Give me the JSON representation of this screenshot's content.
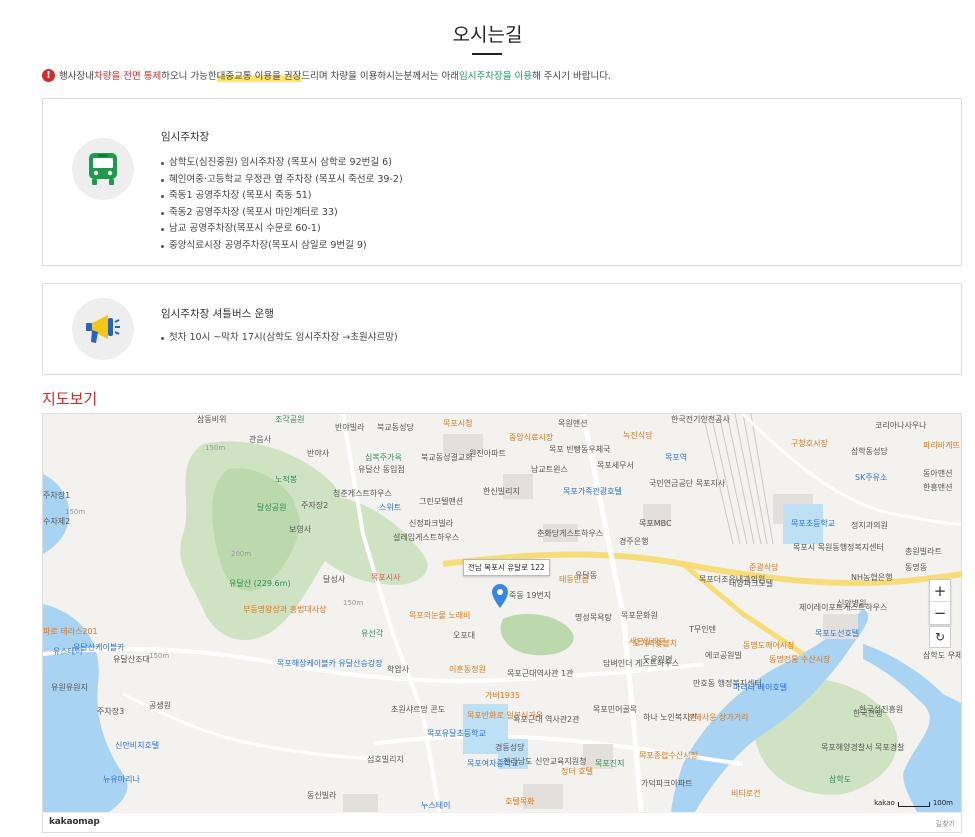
{
  "page": {
    "title": "오시는길"
  },
  "notice": {
    "icon": "warning-icon",
    "parts": [
      {
        "text": "행사장내 ",
        "style": "plain"
      },
      {
        "text": "차량을 전면 통제",
        "style": "red"
      },
      {
        "text": " 하오니 가능한 ",
        "style": "plain"
      },
      {
        "text": "대중교통 이용을 권장",
        "style": "highlight"
      },
      {
        "text": "드리며 차량을 이용하시는분께서는 아래 ",
        "style": "plain"
      },
      {
        "text": "임시주차장을 이용",
        "style": "green"
      },
      {
        "text": "해 주시기 바랍니다.",
        "style": "plain"
      }
    ]
  },
  "parking": {
    "icon": "bus-icon",
    "title": "임시주차장",
    "items": [
      "삼학도(심진중원) 임시주차장 (목포시 삼학로 92번길 6)",
      "혜인여중·고등학교 우정관 옆 주차장 (목포시 죽선로 39-2)",
      "죽동1 공영주차장 (목포시 죽동 51)",
      "죽동2 공영주차장 (목포시 마인계터로 33)",
      "남교 공영주차장(목포시 수문로 60-1)",
      "중앙식료시장 공영주차장(목포시 삼일로 9번길 9)"
    ]
  },
  "shuttle": {
    "icon": "megaphone-icon",
    "title": "임시주차장 셔틀버스 운행",
    "items": [
      "첫차 10시 ~막차 17시(삼학도 임시주차장 →초원샤르망)"
    ]
  },
  "map": {
    "heading": "지도보기",
    "marker_label": "전남 목포시 유달로 122",
    "zoom_in": "+",
    "zoom_out": "−",
    "reset": "↻",
    "logo": "kakaomap",
    "scale_label": "kakao",
    "scale_value": "100m",
    "feedback": "길찾기",
    "labels": [
      {
        "t": "삼동비위",
        "c": ""
      },
      {
        "t": "조각공원",
        "c": "g"
      },
      {
        "t": "반야빌라",
        "c": ""
      },
      {
        "t": "북교동성당",
        "c": ""
      },
      {
        "t": "목포시청",
        "c": "o"
      },
      {
        "t": "중앙식료시장",
        "c": "o"
      },
      {
        "t": "목원맨션",
        "c": ""
      },
      {
        "t": "한국전기안전공사",
        "c": ""
      },
      {
        "t": "녹진식당",
        "c": "o"
      },
      {
        "t": "구청호시장",
        "c": "o"
      },
      {
        "t": "코리아나사우나",
        "c": ""
      },
      {
        "t": "파리바게뜨",
        "c": "o"
      },
      {
        "t": "관음사",
        "c": ""
      },
      {
        "t": "반야사",
        "c": ""
      },
      {
        "t": "심복주가옥",
        "c": "g"
      },
      {
        "t": "북교동성결교회",
        "c": ""
      },
      {
        "t": "원진아파트",
        "c": ""
      },
      {
        "t": "목포 빈빵동우체국",
        "c": ""
      },
      {
        "t": "목포세무서",
        "c": ""
      },
      {
        "t": "목포역",
        "c": "b"
      },
      {
        "t": "삼학동성당",
        "c": ""
      },
      {
        "t": "동아맨션",
        "c": ""
      },
      {
        "t": "유달산 동입점",
        "c": ""
      },
      {
        "t": "남교트윈스",
        "c": ""
      },
      {
        "t": "국민연금공단 목포지사",
        "c": ""
      },
      {
        "t": "SK주유소",
        "c": "b"
      },
      {
        "t": "한흥맨션",
        "c": ""
      },
      {
        "t": "청춘게스트하우스",
        "c": ""
      },
      {
        "t": "한신빌리지",
        "c": ""
      },
      {
        "t": "목포가족관광호텔",
        "c": "b"
      },
      {
        "t": "그린모텔맨션",
        "c": ""
      },
      {
        "t": "달성공원",
        "c": "g"
      },
      {
        "t": "노적봉",
        "c": "g"
      },
      {
        "t": "주자장2",
        "c": ""
      },
      {
        "t": "주차장1",
        "c": ""
      },
      {
        "t": "스위트",
        "c": "b"
      },
      {
        "t": "목포MBC",
        "c": ""
      },
      {
        "t": "신정파크빌라",
        "c": ""
      },
      {
        "t": "정지과의원",
        "c": ""
      },
      {
        "t": "목포초등학교",
        "c": "b"
      },
      {
        "t": "보영사",
        "c": ""
      },
      {
        "t": "설레임게스트하우스",
        "c": ""
      },
      {
        "t": "춘화당게스트하우스",
        "c": ""
      },
      {
        "t": "경주은행",
        "c": ""
      },
      {
        "t": "목포시 목원동행정복지센터",
        "c": ""
      },
      {
        "t": "총원빌라트",
        "c": ""
      },
      {
        "t": "준광식당",
        "c": "o"
      },
      {
        "t": "동명동",
        "c": ""
      },
      {
        "t": "유달산 (229.6m)",
        "c": "g"
      },
      {
        "t": "달성사",
        "c": ""
      },
      {
        "t": "목포시사",
        "c": "r"
      },
      {
        "t": "유달동",
        "c": ""
      },
      {
        "t": "목포더조은내과의원",
        "c": ""
      },
      {
        "t": "태동반점",
        "c": "o"
      },
      {
        "t": "NH농협은행",
        "c": ""
      },
      {
        "t": "부등명왕상과 흥법대사상",
        "c": "o"
      },
      {
        "t": "목포의눈물 노래비",
        "c": "o"
      },
      {
        "t": "오포대",
        "c": ""
      },
      {
        "t": "죽동 19번지",
        "c": ""
      },
      {
        "t": "명성목욕탕",
        "c": ""
      },
      {
        "t": "대양파크모텔",
        "c": ""
      },
      {
        "t": "신안병원",
        "c": ""
      },
      {
        "t": "유선각",
        "c": "g"
      },
      {
        "t": "목포문화원",
        "c": ""
      },
      {
        "t": "오거리숯불치",
        "c": "o"
      },
      {
        "t": "제이레이포트게스트하우스",
        "c": ""
      },
      {
        "t": "목포도선호텔",
        "c": "b"
      },
      {
        "t": "유달산조대",
        "c": ""
      },
      {
        "t": "목포해상케이블카 유달산승강장",
        "c": "b"
      },
      {
        "t": "T무인텐",
        "c": ""
      },
      {
        "t": "세븐일레븐",
        "c": "o"
      },
      {
        "t": "동명도깨어시장",
        "c": "o"
      },
      {
        "t": "동명전통 수산시장",
        "c": "o"
      },
      {
        "t": "삼학도 우체국",
        "c": ""
      },
      {
        "t": "학암사",
        "c": ""
      },
      {
        "t": "이훈동정원",
        "c": "o"
      },
      {
        "t": "목포근대역사관 1관",
        "c": ""
      },
      {
        "t": "담벼인더 게스트하우스",
        "c": ""
      },
      {
        "t": "두우인면",
        "c": ""
      },
      {
        "t": "에코공원빌",
        "c": ""
      },
      {
        "t": "만호동 행정복지센터",
        "c": ""
      },
      {
        "t": "마리나 베이호텔",
        "c": "b"
      },
      {
        "t": "한국전쟁",
        "c": ""
      },
      {
        "t": "가버1935",
        "c": "o"
      },
      {
        "t": "초원샤르망 콘도",
        "c": ""
      },
      {
        "t": "목포반화로 일본식가옥",
        "c": "o"
      },
      {
        "t": "목포근대 역사관2관",
        "c": ""
      },
      {
        "t": "목포민어골목",
        "c": ""
      },
      {
        "t": "하나 노인복지관",
        "c": ""
      },
      {
        "t": "건해사운 상가거리",
        "c": "o"
      },
      {
        "t": "한국섬진흥원",
        "c": ""
      },
      {
        "t": "목포유달초등학교",
        "c": "b"
      },
      {
        "t": "경동성당",
        "c": ""
      },
      {
        "t": "목포여자중학교",
        "c": "b"
      },
      {
        "t": "전라남도 신안교육지원청",
        "c": ""
      },
      {
        "t": "목포진지",
        "c": "g"
      },
      {
        "t": "목포종합수산시장",
        "c": "o"
      },
      {
        "t": "목포해양경찰서 목포경찰",
        "c": ""
      },
      {
        "t": "섬호빌리지",
        "c": ""
      },
      {
        "t": "정터 호텔",
        "c": "o"
      },
      {
        "t": "가덕파크아파트",
        "c": ""
      },
      {
        "t": "삼학도",
        "c": "g"
      },
      {
        "t": "동신빌라",
        "c": ""
      },
      {
        "t": "누스테이",
        "c": "b"
      },
      {
        "t": "호텔목화",
        "c": "o"
      },
      {
        "t": "비티로건",
        "c": "o"
      },
      {
        "t": "유달산케이블카",
        "c": "b"
      },
      {
        "t": "주차장3",
        "c": ""
      },
      {
        "t": "신안비치호텔",
        "c": "b"
      },
      {
        "t": "뉴유마리나",
        "c": "b"
      },
      {
        "t": "공생원",
        "c": ""
      },
      {
        "t": "유원유원지",
        "c": ""
      },
      {
        "t": "유스테이",
        "c": "b"
      },
      {
        "t": "파로 테라스201",
        "c": "o"
      },
      {
        "t": "수자제2",
        "c": ""
      },
      {
        "t": "150m",
        "c": "s"
      },
      {
        "t": "200m",
        "c": "s"
      },
      {
        "t": "150m",
        "c": "s"
      },
      {
        "t": "150m",
        "c": "s"
      },
      {
        "t": "150m",
        "c": "s"
      }
    ]
  }
}
